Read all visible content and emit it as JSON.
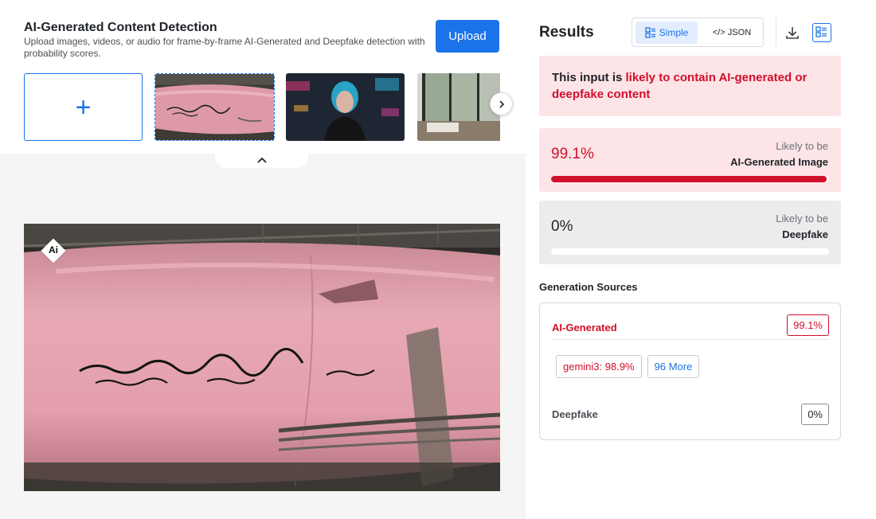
{
  "header": {
    "title": "AI-Generated Content Detection",
    "description": "Upload images, videos, or audio for frame-by-frame AI-Generated and Deepfake detection with probability scores.",
    "upload_label": "Upload"
  },
  "gallery": {
    "add_icon": "plus-icon",
    "next_icon": "chevron-right-icon",
    "collapse_icon": "chevron-up-icon"
  },
  "preview": {
    "badge_text": "Ai"
  },
  "results": {
    "title": "Results",
    "view_simple": "Simple",
    "view_json": "</> JSON",
    "icons": [
      "list-view-icon",
      "download-icon",
      "detail-view-icon"
    ],
    "verdict_prefix": "This input is ",
    "verdict_highlight": "likely to contain AI-generated or deepfake content",
    "scores": [
      {
        "value": "99.1%",
        "fraction": 0.991,
        "note_top": "Likely to be",
        "note_bottom": "AI-Generated Image"
      },
      {
        "value": "0%",
        "fraction": 0.0,
        "note_top": "Likely to be",
        "note_bottom": "Deepfake"
      }
    ]
  },
  "sources": {
    "title": "Generation Sources",
    "ai_label": "AI-Generated",
    "ai_value": "99.1%",
    "chips": [
      "gemini3: 98.9%",
      "96 More"
    ],
    "deepfake_label": "Deepfake",
    "deepfake_value": "0%"
  },
  "colors": {
    "accent": "#1a73e8",
    "danger": "#d10f2c",
    "danger_bg": "#fde4e6",
    "neutral_bg": "#ececed"
  }
}
